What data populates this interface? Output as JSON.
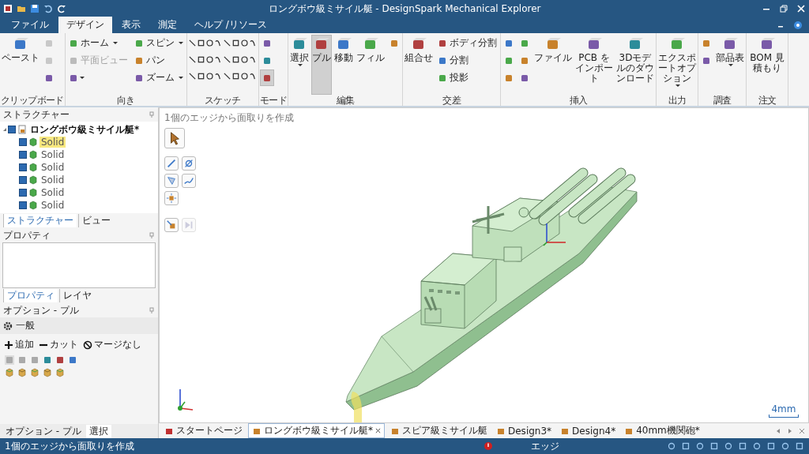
{
  "window": {
    "title": "ロングボウ級ミサイル艇 - DesignSpark Mechanical Explorer"
  },
  "menu_tabs": [
    {
      "label": "ファイル",
      "selected": false
    },
    {
      "label": "デザイン",
      "selected": true
    },
    {
      "label": "表示",
      "selected": false
    },
    {
      "label": "測定",
      "selected": false
    },
    {
      "label": "ヘルプ /リソース",
      "selected": false
    }
  ],
  "ribbon": {
    "groups": [
      {
        "label": "クリップボード",
        "kind": "columns",
        "columns": [
          [
            {
              "kind": "large",
              "label": "ペースト",
              "selected": false,
              "disabled": false,
              "dropdown": false
            }
          ],
          [
            {
              "kind": "icon",
              "selected": false,
              "disabled": true,
              "dropdown": false
            },
            {
              "kind": "icon",
              "selected": false,
              "disabled": true,
              "dropdown": false
            },
            {
              "kind": "icon",
              "selected": false,
              "disabled": false,
              "dropdown": false
            }
          ]
        ]
      },
      {
        "label": "向き",
        "kind": "columns",
        "columns": [
          [
            {
              "kind": "small",
              "label": "ホーム",
              "selected": false,
              "disabled": false,
              "dropdown": true
            },
            {
              "kind": "small",
              "label": "平面ビュー",
              "selected": false,
              "disabled": true,
              "dropdown": false
            },
            {
              "kind": "icon",
              "selected": false,
              "disabled": false,
              "dropdown": true
            }
          ],
          [
            {
              "kind": "small",
              "label": "スピン",
              "selected": false,
              "disabled": false,
              "dropdown": true
            },
            {
              "kind": "small",
              "label": "パン",
              "selected": false,
              "disabled": false,
              "dropdown": false
            },
            {
              "kind": "small",
              "label": "ズーム",
              "selected": false,
              "disabled": false,
              "dropdown": true
            }
          ]
        ]
      },
      {
        "label": "スケッチ",
        "kind": "grid"
      },
      {
        "label": "モード",
        "kind": "columns",
        "columns": [
          [
            {
              "kind": "icon",
              "selected": false,
              "disabled": false,
              "dropdown": false
            },
            {
              "kind": "icon",
              "selected": false,
              "disabled": false,
              "dropdown": false
            },
            {
              "kind": "icon",
              "selected": true,
              "disabled": false,
              "dropdown": false
            }
          ]
        ]
      },
      {
        "label": "編集",
        "kind": "columns",
        "columns": [
          [
            {
              "kind": "large",
              "label": "選択",
              "selected": false,
              "disabled": false,
              "dropdown": true
            }
          ],
          [
            {
              "kind": "large",
              "label": "プル",
              "selected": true,
              "disabled": false,
              "dropdown": false
            }
          ],
          [
            {
              "kind": "large",
              "label": "移動",
              "selected": false,
              "disabled": false,
              "dropdown": false
            }
          ],
          [
            {
              "kind": "large",
              "label": "フィル",
              "selected": false,
              "disabled": false,
              "dropdown": false
            }
          ],
          [
            {
              "kind": "icon",
              "selected": false,
              "disabled": false,
              "dropdown": false
            }
          ]
        ]
      },
      {
        "label": "交差",
        "kind": "columns",
        "columns": [
          [
            {
              "kind": "large",
              "label": "組合せ",
              "selected": false,
              "disabled": false,
              "dropdown": false
            }
          ],
          [
            {
              "kind": "small",
              "label": "ボディ分割",
              "selected": false,
              "disabled": false,
              "dropdown": false
            },
            {
              "kind": "small",
              "label": "分割",
              "selected": false,
              "disabled": false,
              "dropdown": false
            },
            {
              "kind": "small",
              "label": "投影",
              "selected": false,
              "disabled": false,
              "dropdown": false
            }
          ]
        ]
      },
      {
        "label": "挿入",
        "kind": "columns",
        "columns": [
          [
            {
              "kind": "icon",
              "selected": false,
              "disabled": false,
              "dropdown": false
            },
            {
              "kind": "icon",
              "selected": false,
              "disabled": false,
              "dropdown": false
            },
            {
              "kind": "icon",
              "selected": false,
              "disabled": false,
              "dropdown": false
            }
          ],
          [
            {
              "kind": "icon",
              "selected": false,
              "disabled": false,
              "dropdown": false
            },
            {
              "kind": "icon",
              "selected": false,
              "disabled": false,
              "dropdown": false
            },
            {
              "kind": "icon",
              "selected": false,
              "disabled": false,
              "dropdown": false
            }
          ],
          [
            {
              "kind": "large",
              "label": "ファイル",
              "selected": false,
              "disabled": false,
              "dropdown": false
            }
          ],
          [
            {
              "kind": "large",
              "label": "PCB をインポート",
              "selected": false,
              "disabled": false,
              "dropdown": false
            }
          ],
          [
            {
              "kind": "large",
              "label": "3Dモデルのダウンロード",
              "selected": false,
              "disabled": false,
              "dropdown": false
            }
          ]
        ]
      },
      {
        "label": "出力",
        "kind": "columns",
        "columns": [
          [
            {
              "kind": "large",
              "label": "エクスポートオプション",
              "selected": false,
              "disabled": false,
              "dropdown": true
            }
          ]
        ]
      },
      {
        "label": "調査",
        "kind": "columns",
        "columns": [
          [
            {
              "kind": "icon",
              "selected": false,
              "disabled": false,
              "dropdown": false
            },
            {
              "kind": "icon",
              "selected": false,
              "disabled": false,
              "dropdown": false
            }
          ],
          [
            {
              "kind": "large",
              "label": "部品表",
              "selected": false,
              "disabled": false,
              "dropdown": true
            }
          ]
        ]
      },
      {
        "label": "注文",
        "kind": "columns",
        "columns": [
          [
            {
              "kind": "large",
              "label": "BOM 見積もり",
              "selected": false,
              "disabled": false,
              "dropdown": false
            }
          ]
        ]
      }
    ]
  },
  "structure_panel": {
    "title": "ストラクチャー",
    "tree": [
      {
        "label": "ロングボウ級ミサイル艇*",
        "checked": true,
        "selected": false,
        "expanded": true,
        "children": [
          {
            "label": "Solid",
            "checked": true,
            "selected": true
          },
          {
            "label": "Solid",
            "checked": true,
            "selected": false
          },
          {
            "label": "Solid",
            "checked": true,
            "selected": false
          },
          {
            "label": "Solid",
            "checked": true,
            "selected": false
          },
          {
            "label": "Solid",
            "checked": true,
            "selected": false
          },
          {
            "label": "Solid",
            "checked": true,
            "selected": false
          }
        ]
      }
    ],
    "tabs": [
      {
        "label": "ストラクチャー",
        "selected": true
      },
      {
        "label": "ビュー",
        "selected": false
      }
    ]
  },
  "properties_panel": {
    "title": "プロパティ",
    "tabs": [
      {
        "label": "プロパティ",
        "selected": true
      },
      {
        "label": "レイヤ",
        "selected": false
      }
    ]
  },
  "options_panel": {
    "title": "オプション - プル",
    "section": "一般",
    "actions": [
      {
        "label": "追加"
      },
      {
        "label": "カット"
      },
      {
        "label": "マージなし"
      }
    ]
  },
  "bottom_tabs": [
    {
      "label": "オプション - プル",
      "selected": false
    },
    {
      "label": "選択",
      "selected": true
    }
  ],
  "viewport": {
    "hint": "1個のエッジから面取りを作成",
    "scale": "4mm"
  },
  "document_tabs": [
    {
      "label": "スタートページ",
      "selected": false
    },
    {
      "label": "ロングボウ級ミサイル艇*",
      "selected": true
    },
    {
      "label": "スピア級ミサイル艇",
      "selected": false
    },
    {
      "label": "Design3*",
      "selected": false
    },
    {
      "label": "Design4*",
      "selected": false
    },
    {
      "label": "40mm機関砲*",
      "selected": false
    }
  ],
  "status_bar": {
    "message": "1個のエッジから面取りを作成",
    "selection_type": "エッジ"
  }
}
